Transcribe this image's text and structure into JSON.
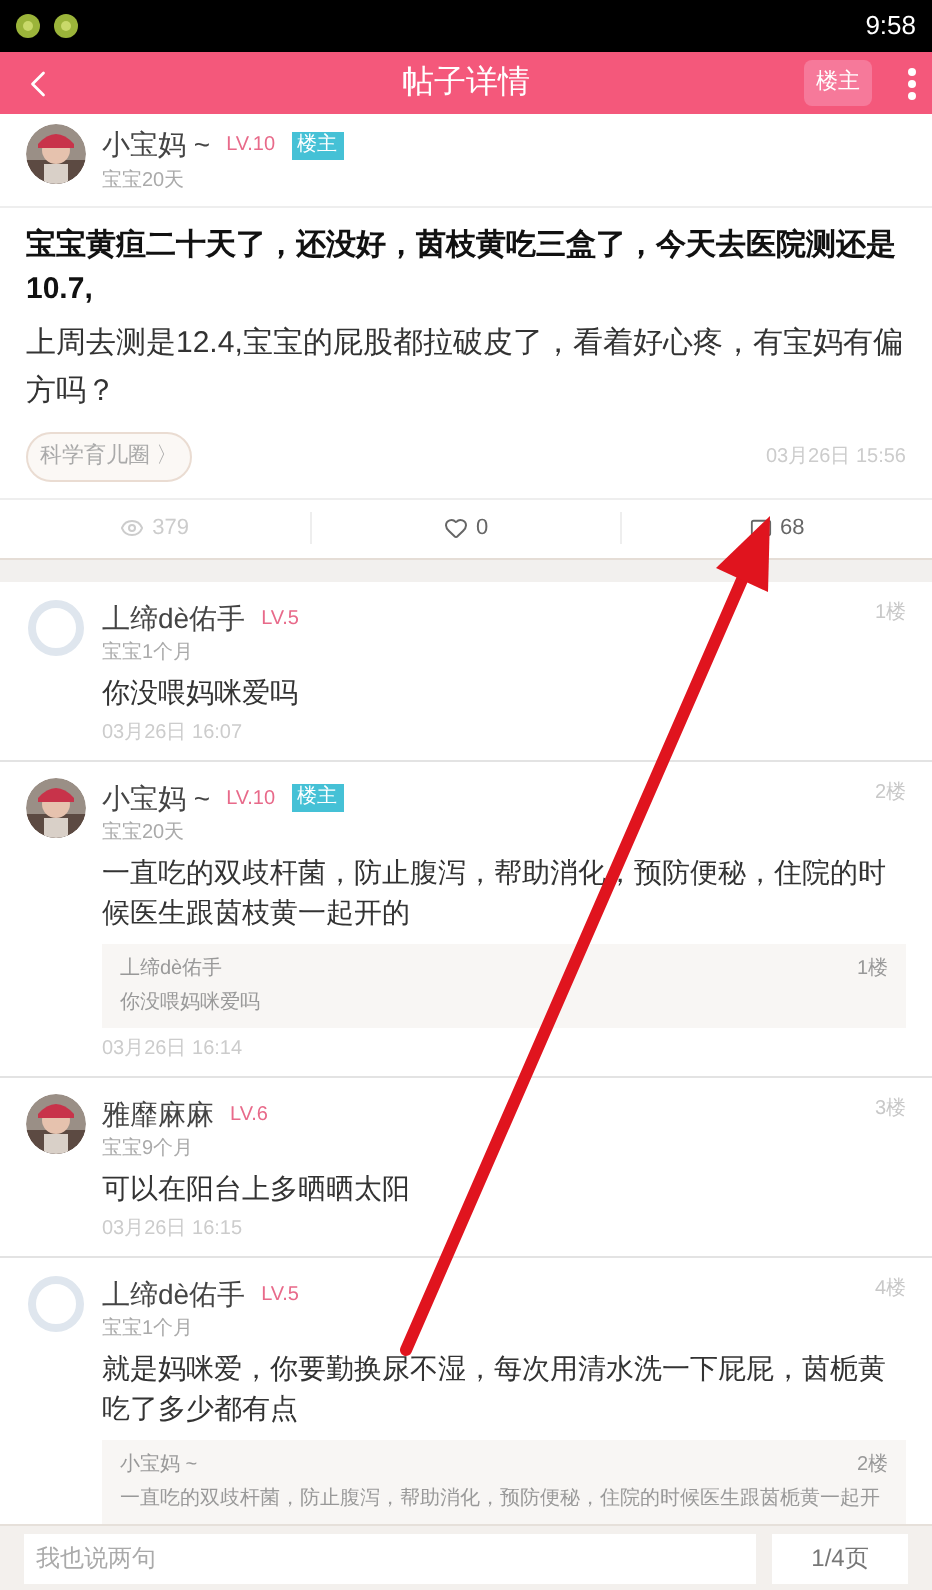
{
  "status_bar": {
    "time": "9:58"
  },
  "header": {
    "title": "帖子详情",
    "op_button": "楼主"
  },
  "post": {
    "author": {
      "name": "小宝妈 ~",
      "level": "LV.10",
      "badge": "楼主",
      "baby_age": "宝宝20天",
      "has_photo": true
    },
    "title": "宝宝黄疸二十天了，还没好，茵枝黄吃三盒了，今天去医院测还是10.7,",
    "body": "上周去测是12.4,宝宝的屁股都拉破皮了，看着好心疼，有宝妈有偏方吗？",
    "circle": "科学育儿圈 〉",
    "time": "03月26日 15:56",
    "stats": {
      "views": "379",
      "likes": "0",
      "comments": "68"
    }
  },
  "comments": [
    {
      "name": "丄缔dè佑手",
      "level": "LV.5",
      "baby_age": "宝宝1个月",
      "has_photo": false,
      "floor": "1楼",
      "text": "你没喂妈咪爱吗",
      "time": "03月26日 16:07"
    },
    {
      "name": "小宝妈 ~",
      "level": "LV.10",
      "badge": "楼主",
      "baby_age": "宝宝20天",
      "has_photo": true,
      "floor": "2楼",
      "text": "一直吃的双歧杆菌，防止腹泻，帮助消化，预防便秘，住院的时候医生跟茵枝黄一起开的",
      "quote": {
        "name": "丄缔dè佑手",
        "floor": "1楼",
        "text": "你没喂妈咪爱吗"
      },
      "time": "03月26日 16:14"
    },
    {
      "name": "雅靡麻麻",
      "level": "LV.6",
      "baby_age": "宝宝9个月",
      "has_photo": true,
      "floor": "3楼",
      "text": "可以在阳台上多晒晒太阳",
      "time": "03月26日 16:15"
    },
    {
      "name": "丄缔dè佑手",
      "level": "LV.5",
      "baby_age": "宝宝1个月",
      "has_photo": false,
      "floor": "4楼",
      "text": "就是妈咪爱，你要勤换尿不湿，每次用清水洗一下屁屁，茵栀黄吃了多少都有点",
      "quote": {
        "name": "小宝妈 ~",
        "floor": "2楼",
        "text": "一直吃的双歧杆菌，防止腹泻，帮助消化，预防便秘，住院的时候医生跟茵栀黄一起开"
      }
    }
  ],
  "bottom_bar": {
    "placeholder": "我也说两句",
    "page": "1/4页"
  }
}
